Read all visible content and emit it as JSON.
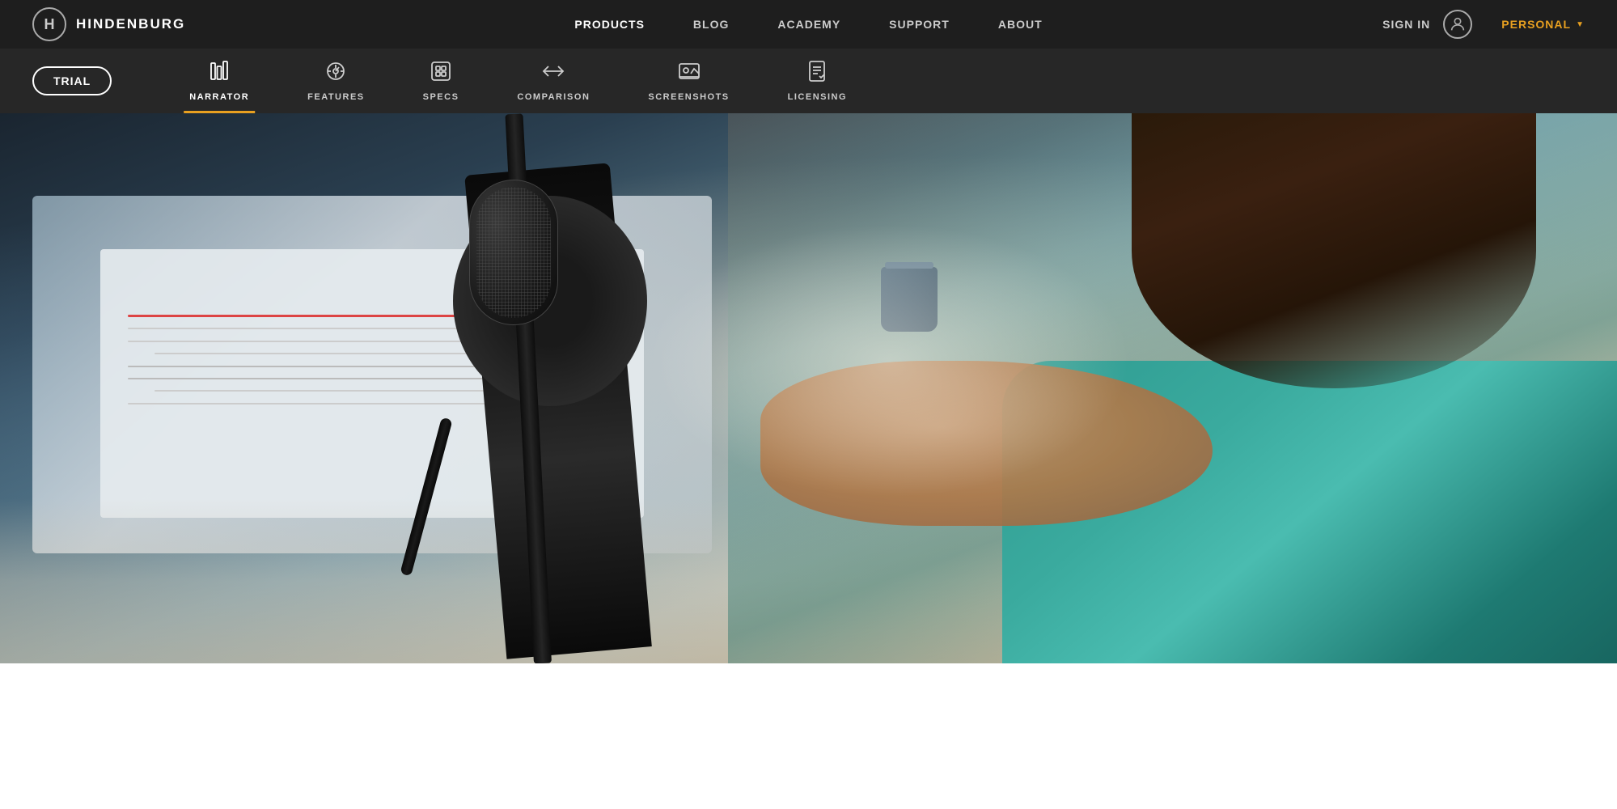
{
  "brand": {
    "logo_letter": "H",
    "name": "HINDENBURG"
  },
  "top_nav": {
    "items": [
      {
        "label": "PRODUCTS",
        "active": true
      },
      {
        "label": "BLOG",
        "active": false
      },
      {
        "label": "ACADEMY",
        "active": false
      },
      {
        "label": "SUPPORT",
        "active": false
      },
      {
        "label": "ABOUT",
        "active": false
      }
    ],
    "sign_in": "SIGN IN",
    "personal": "PERSONAL"
  },
  "sub_nav": {
    "trial_button": "TRIAL",
    "tabs": [
      {
        "id": "narrator",
        "label": "NARRATOR",
        "icon": "bars",
        "active": true
      },
      {
        "id": "features",
        "label": "FEATURES",
        "icon": "gauge",
        "active": false
      },
      {
        "id": "specs",
        "label": "SPECS",
        "icon": "chip",
        "active": false
      },
      {
        "id": "comparison",
        "label": "COMPARISON",
        "icon": "arrows",
        "active": false
      },
      {
        "id": "screenshots",
        "label": "SCREENSHOTS",
        "icon": "image",
        "active": false
      },
      {
        "id": "licensing",
        "label": "LICENSING",
        "icon": "document",
        "active": false
      }
    ]
  },
  "colors": {
    "accent_orange": "#e8a020",
    "top_bar_bg": "#1e1e1e",
    "sub_bar_bg": "#272727",
    "active_underline": "#e8a020"
  }
}
